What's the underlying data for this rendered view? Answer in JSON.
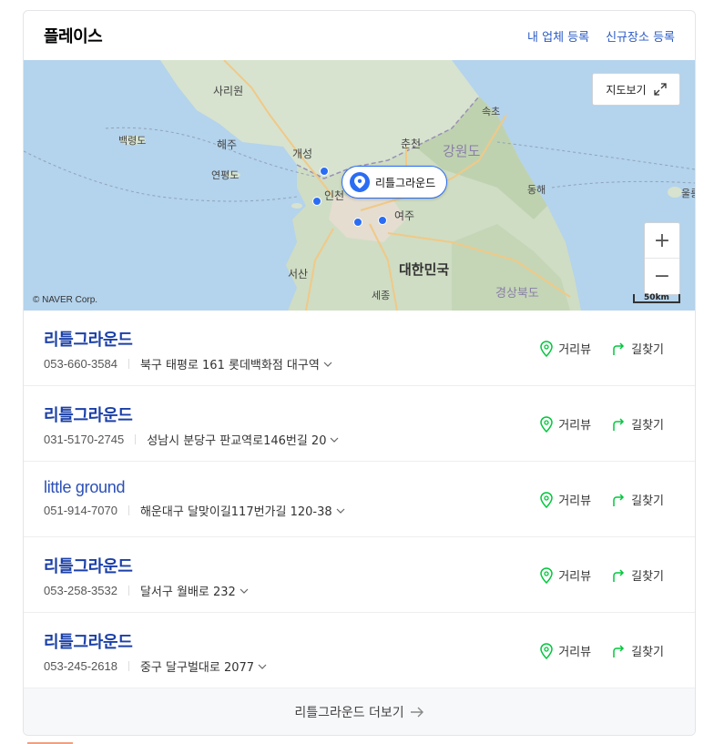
{
  "header": {
    "title": "플레이스",
    "links": [
      "내 업체 등록",
      "신규장소 등록"
    ]
  },
  "map": {
    "view_button_label": "지도보기",
    "pin_label": "리틀그라운드",
    "copyright": "© NAVER Corp.",
    "scale_label": "50km",
    "zoom_in_label": "+",
    "zoom_out_label": "−",
    "places": [
      {
        "name": "사리원"
      },
      {
        "name": "백령도"
      },
      {
        "name": "해주"
      },
      {
        "name": "연평도"
      },
      {
        "name": "개성"
      },
      {
        "name": "춘천"
      },
      {
        "name": "강원도"
      },
      {
        "name": "속초"
      },
      {
        "name": "동해"
      },
      {
        "name": "울릉"
      },
      {
        "name": "인천"
      },
      {
        "name": "여주"
      },
      {
        "name": "서산"
      },
      {
        "name": "대한민국"
      },
      {
        "name": "세종"
      },
      {
        "name": "경상북도"
      }
    ]
  },
  "results": [
    {
      "name": "리틀그라운드",
      "phone": "053-660-3584",
      "address": "북구 태평로 161 롯데백화점 대구역",
      "style": "bold"
    },
    {
      "name": "리틀그라운드",
      "phone": "031-5170-2745",
      "address": "성남시 분당구 판교역로146번길 20",
      "style": "bold"
    },
    {
      "name": "little ground",
      "phone": "051-914-7070",
      "address": "해운대구 달맞이길117번가길 120-38",
      "style": "light"
    },
    {
      "name": "리틀그라운드",
      "phone": "053-258-3532",
      "address": "달서구 월배로 232",
      "style": "bold"
    },
    {
      "name": "리틀그라운드",
      "phone": "053-245-2618",
      "address": "중구 달구벌대로 2077",
      "style": "bold"
    }
  ],
  "actions": {
    "street_view": "거리뷰",
    "directions": "길찾기"
  },
  "more_label": "리틀그라운드 더보기",
  "colors": {
    "link_blue": "#2a5bc6",
    "name_blue": "#1a3fa8",
    "pin_blue": "#2a6df4",
    "action_green": "#00c73c"
  }
}
